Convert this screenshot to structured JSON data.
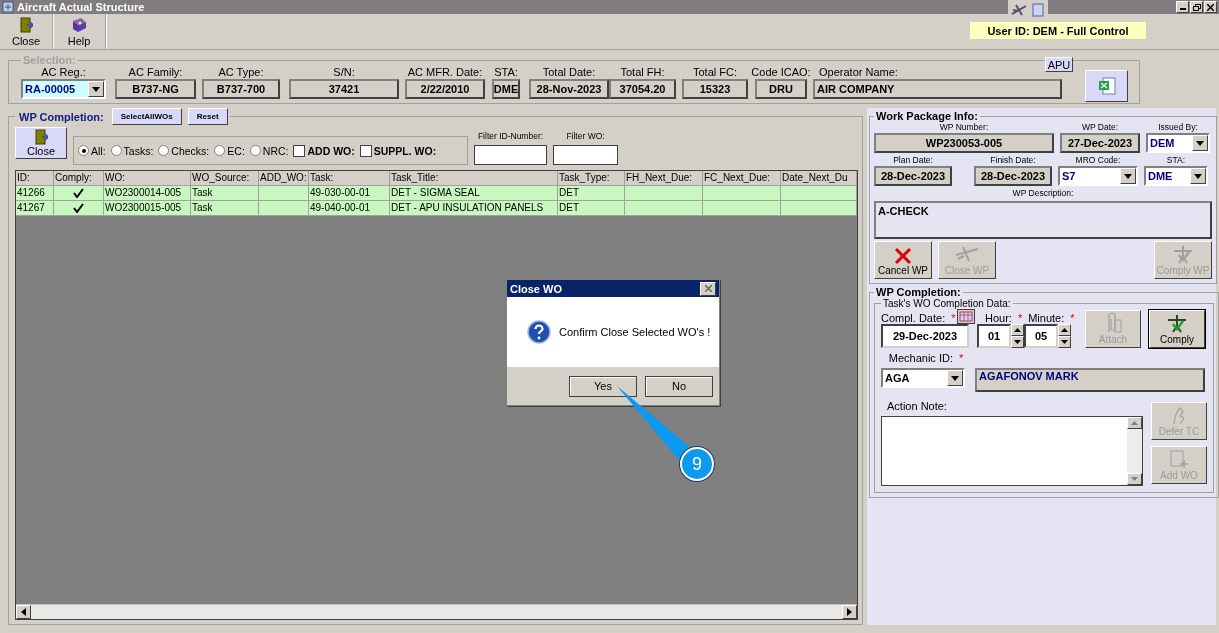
{
  "window": {
    "title": "Aircraft Actual Structure",
    "user_badge": "User ID: DEM - Full Control"
  },
  "toolbar": [
    {
      "label": "Close",
      "kind": "close"
    },
    {
      "label": "Help",
      "kind": "help"
    }
  ],
  "selection": {
    "legend": "Selection:",
    "apu_button": "APU",
    "fields": [
      {
        "label": "AC Reg.:",
        "value": "RA-00005",
        "kind": "combo"
      },
      {
        "label": "AC Family:",
        "value": "B737-NG",
        "kind": "box"
      },
      {
        "label": "AC Type:",
        "value": "B737-700",
        "kind": "box"
      },
      {
        "label": "S/N:",
        "value": "37421",
        "kind": "box"
      },
      {
        "label": "AC MFR. Date:",
        "value": "2/22/2010",
        "kind": "box"
      },
      {
        "label": "STA:",
        "value": "DME",
        "kind": "box"
      },
      {
        "label": "Total Date:",
        "value": "28-Nov-2023",
        "kind": "box"
      },
      {
        "label": "Total FH:",
        "value": "37054.20",
        "kind": "box"
      },
      {
        "label": "Total FC:",
        "value": "15323",
        "kind": "box"
      },
      {
        "label": "Code ICAO:",
        "value": "DRU",
        "kind": "box"
      },
      {
        "label": "Operator Name:",
        "value": "AIR COMPANY",
        "kind": "wide"
      }
    ]
  },
  "wo_list": {
    "legend": "WP Completion:",
    "select_all_button": "SelectAllWOs",
    "reset_button": "Reset",
    "close_button": "Close",
    "radios": [
      {
        "label": "All:",
        "selected": true
      },
      {
        "label": "Tasks:",
        "selected": false
      },
      {
        "label": "Checks:",
        "selected": false
      },
      {
        "label": "EC:",
        "selected": false
      },
      {
        "label": "NRC:",
        "selected": false
      }
    ],
    "checkboxes": [
      {
        "label": "ADD WO:",
        "checked": false
      },
      {
        "label": "SUPPL. WO:",
        "checked": false
      }
    ],
    "filters": [
      {
        "label": "Filter ID-Number:"
      },
      {
        "label": "Filter WO:"
      }
    ],
    "table": {
      "columns": [
        "ID:",
        "Comply:",
        "WO:",
        "WO_Source:",
        "ADD_WO:",
        "Task:",
        "Task_Title:",
        "Task_Type:",
        "FH_Next_Due:",
        "FC_Next_Due:",
        "Date_Next_Du"
      ],
      "rows": [
        {
          "id": "41266",
          "comply": true,
          "wo": "WO2300014-005",
          "wo_source": "Task",
          "task": "49-030-00-01",
          "task_title": "DET - SIGMA SEAL",
          "task_type": "DET"
        },
        {
          "id": "41267",
          "comply": true,
          "wo": "WO2300015-005",
          "wo_source": "Task",
          "task": "49-040-00-01",
          "task_title": "DET - APU INSULATION PANELS",
          "task_type": "DET"
        }
      ]
    }
  },
  "work_package": {
    "legend": "Work Package Info:",
    "wp_number": {
      "label": "WP Number:",
      "value": "WP230053-005"
    },
    "wp_date": {
      "label": "WP Date:",
      "value": "27-Dec-2023"
    },
    "issued_by": {
      "label": "Issued By:",
      "value": "DEM"
    },
    "plan_date": {
      "label": "Plan Date:",
      "value": "28-Dec-2023"
    },
    "finish_date": {
      "label": "Finish Date:",
      "value": "28-Dec-2023"
    },
    "mro_code": {
      "label": "MRO Code:",
      "value": "S7"
    },
    "sta": {
      "label": "STA:",
      "value": "DME"
    },
    "description": {
      "label": "WP Description:",
      "value": "A-CHECK"
    },
    "buttons": [
      {
        "label": "Cancel WP",
        "kind": "cancel",
        "disabled": false
      },
      {
        "label": "Close WP",
        "kind": "close",
        "disabled": true
      },
      {
        "label": "Comply WP",
        "kind": "comply",
        "disabled": true
      }
    ]
  },
  "task_completion": {
    "legend": "WP Completion:",
    "sublegend": "Task's WO Completion Data:",
    "compl_date": {
      "label": "Compl. Date:",
      "required_mark": "*",
      "value": "29-Dec-2023"
    },
    "hour": {
      "label": "Hour:",
      "required_mark": "*",
      "value": "01"
    },
    "minute": {
      "label": "Minute:",
      "required_mark": "*",
      "value": "05"
    },
    "mechanic": {
      "label": "Mechanic ID:",
      "required_mark": "*",
      "value": "AGA",
      "name": "AGAFONOV MARK"
    },
    "action_note": {
      "label": "Action Note:"
    },
    "buttons": [
      {
        "label": "Attach",
        "kind": "attach",
        "disabled": true
      },
      {
        "label": "Comply",
        "kind": "comply",
        "disabled": false
      },
      {
        "label": "Defer TC",
        "kind": "defer",
        "disabled": true
      },
      {
        "label": "Add WO",
        "kind": "add",
        "disabled": true
      }
    ]
  },
  "dialog": {
    "title": "Close WO",
    "message": "Confirm Close Selected WO's !",
    "buttons": [
      "Yes",
      "No"
    ]
  },
  "callout": {
    "label": "9"
  }
}
